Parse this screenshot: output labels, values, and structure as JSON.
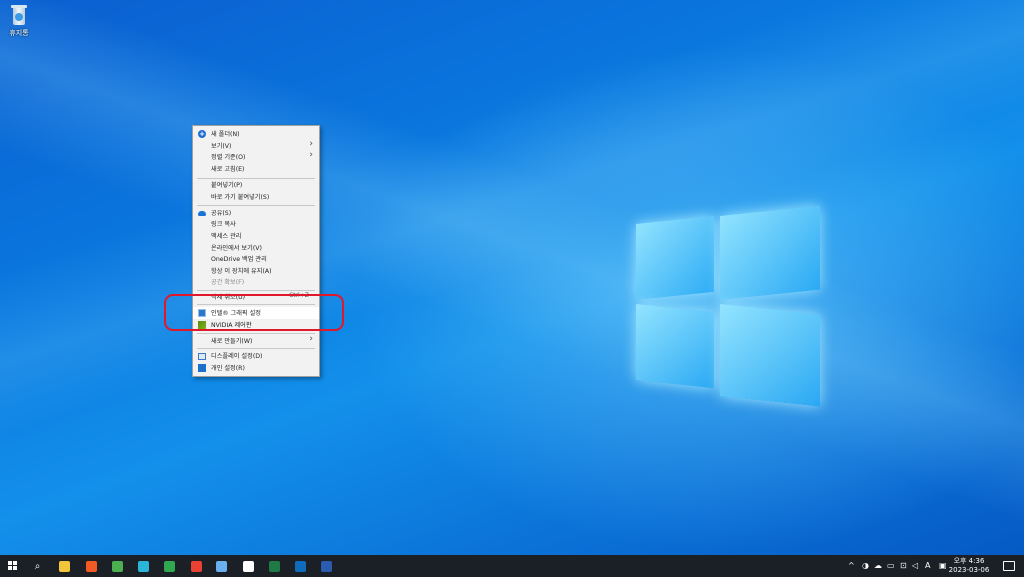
{
  "desktop": {
    "recycle_bin_label": "휴지통"
  },
  "context_menu": {
    "items": [
      {
        "label": "새 폴더(N)",
        "icon": "plus-circle-icon"
      },
      {
        "label": "보기(V)",
        "submenu": true
      },
      {
        "label": "정렬 기준(O)",
        "submenu": true
      },
      {
        "label": "새로 고침(E)"
      },
      {
        "label": "붙여넣기(P)"
      },
      {
        "label": "바로 가기 붙여넣기(S)"
      },
      {
        "label": "공유(S)",
        "icon": "onedrive-cloud-icon"
      },
      {
        "label": "링크 복사"
      },
      {
        "label": "액세스 관리"
      },
      {
        "label": "온라인에서 보기(V)"
      },
      {
        "label": "OneDrive 백업 관리"
      },
      {
        "label": "항상 이 장치에 유지(A)"
      },
      {
        "label": "공간 확보(F)",
        "disabled": true
      },
      {
        "label": "삭제 취소(U)",
        "shortcut": "Ctrl+Z"
      },
      {
        "label": "인텔® 그래픽 설정",
        "icon": "intel-graphics-icon"
      },
      {
        "label": "NVIDIA 제어판",
        "icon": "nvidia-icon"
      },
      {
        "label": "새로 만들기(W)",
        "submenu": true
      },
      {
        "label": "디스플레이 설정(D)",
        "icon": "display-settings-icon"
      },
      {
        "label": "개인 설정(R)",
        "icon": "personalize-icon"
      }
    ]
  },
  "annotation": {
    "color": "#e0182a"
  },
  "taskbar": {
    "apps": [
      {
        "name": "file-explorer-icon",
        "color": "#f3c53b"
      },
      {
        "name": "brave-browser-icon",
        "color": "#f15a24"
      },
      {
        "name": "chrome-icon",
        "color": "#4caf50"
      },
      {
        "name": "kiwi-app-icon",
        "color": "#29b6d8"
      },
      {
        "name": "shield-app-icon",
        "color": "#2fa84f"
      },
      {
        "name": "circle-app-icon",
        "color": "#e94235"
      },
      {
        "name": "tablet-app-icon",
        "color": "#6ab0f0"
      },
      {
        "name": "notion-icon",
        "color": "#ffffff"
      },
      {
        "name": "excel-icon",
        "color": "#1f7a45"
      },
      {
        "name": "outlook-icon",
        "color": "#0f6cbd"
      },
      {
        "name": "word-icon",
        "color": "#2b5cb0"
      }
    ],
    "tray": {
      "ime": "A",
      "time": "오후 4:36",
      "date": "2023-03-06"
    }
  }
}
